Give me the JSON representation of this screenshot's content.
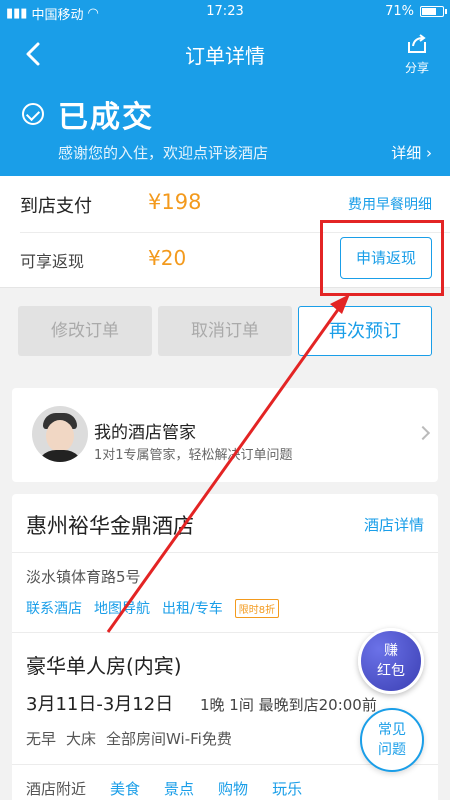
{
  "status_bar": {
    "carrier": "中国移动",
    "time": "17:23",
    "battery": "71%",
    "battery_level": 0.71
  },
  "header": {
    "title": "订单详情",
    "share_label": "分享",
    "status": "已成交",
    "subtitle": "感谢您的入住，欢迎点评该酒店",
    "detail_link": "详细 ›"
  },
  "payment": {
    "pay_label": "到店支付",
    "pay_amount": "¥198",
    "breakfast_link": "费用早餐明细",
    "cashback_label": "可享返现",
    "cashback_amount": "¥20",
    "apply_button": "申请返现"
  },
  "actions": {
    "modify": "修改订单",
    "cancel": "取消订单",
    "rebook": "再次预订"
  },
  "butler": {
    "name": "我的酒店管家",
    "desc": "1对1专属管家，轻松解决订单问题"
  },
  "hotel": {
    "name": "惠州裕华金鼎酒店",
    "detail_link": "酒店详情",
    "address": "淡水镇体育路5号",
    "links": [
      "联系酒店",
      "地图导航",
      "出租/专车"
    ],
    "badge": "限时8折",
    "room": "豪华单人房(内宾)",
    "dates": "3月11日-3月12日",
    "stay_info": "1晚 1间  最晚到店20:00前",
    "amenities": [
      "无早",
      "大床",
      "全部房间Wi-Fi免费"
    ],
    "nearby_label": "酒店附近",
    "nearby": [
      "美食",
      "景点",
      "购物",
      "玩乐"
    ]
  },
  "floating": {
    "earn_line1": "赚",
    "earn_line2": "红包",
    "faq_line1": "常见",
    "faq_line2": "问题"
  },
  "colors": {
    "brand": "#1a9ee8",
    "price": "#f39a1d",
    "annotation": "#e32424"
  }
}
